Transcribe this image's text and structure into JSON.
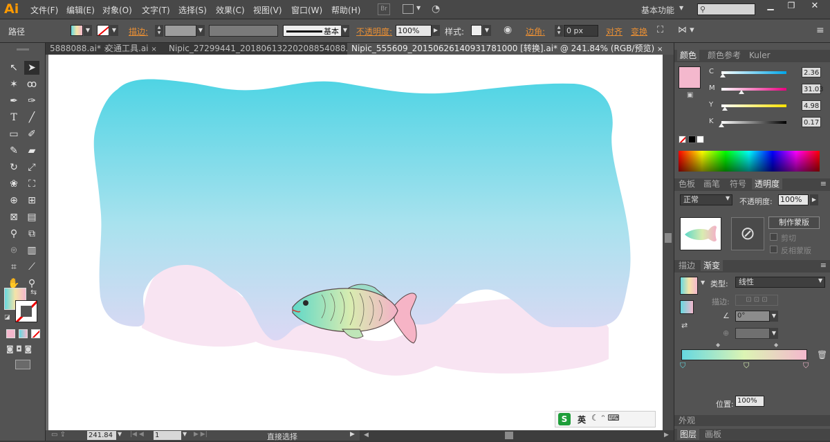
{
  "app": {
    "logo": "Ai",
    "workspace": "基本功能"
  },
  "menu": [
    "文件(F)",
    "编辑(E)",
    "对象(O)",
    "文字(T)",
    "选择(S)",
    "效果(C)",
    "视图(V)",
    "窗口(W)",
    "帮助(H)"
  ],
  "control": {
    "selection_label": "路径",
    "stroke_label": "描边:",
    "stroke_style": "基本",
    "opacity_label": "不透明度:",
    "opacity_value": "100%",
    "style_label": "样式:",
    "corner_label": "边角:",
    "corner_value": "0 px",
    "align_label": "对齐",
    "transform_label": "变换",
    "br_badge": "Br"
  },
  "tabs": [
    {
      "label": "5888088.ai*",
      "active": false
    },
    {
      "label": "交通工具.ai",
      "active": false
    },
    {
      "label": "Nipic_27299441_20180613220208854088.ai*",
      "active": false
    },
    {
      "label": "Nipic_555609_20150626140931781000 [转换].ai* @ 241.84% (RGB/预览)",
      "active": true
    }
  ],
  "status": {
    "zoom": "241.84",
    "page": "1",
    "tool": "直接选择"
  },
  "color_panel": {
    "tabs": [
      "颜色",
      "颜色参考",
      "Kuler"
    ],
    "channels": [
      {
        "name": "C",
        "value": "2.36",
        "level": 0.0236
      },
      {
        "name": "M",
        "value": "31.03",
        "level": 0.3103
      },
      {
        "name": "Y",
        "value": "4.98",
        "level": 0.0498
      },
      {
        "name": "K",
        "value": "0.17",
        "level": 0.0017
      }
    ],
    "swatch_color": "#f4b8cd"
  },
  "transparency_panel": {
    "tabs": [
      "色板",
      "画笔",
      "符号",
      "透明度"
    ],
    "blend_mode": "正常",
    "opacity_label": "不透明度:",
    "opacity_value": "100%",
    "make_mask": "制作蒙版",
    "clip": "剪切",
    "invert_mask": "反相蒙版"
  },
  "gradient_panel": {
    "tabs": [
      "描边",
      "渐变"
    ],
    "type_label": "类型:",
    "type_value": "线性",
    "stroke_label": "描边:",
    "angle_value": "0°",
    "location_label": "位置:",
    "location_value": "100%"
  },
  "bottom_panel": {
    "appearance": "外观",
    "layers": "图层",
    "artboard": "画板"
  },
  "ime": {
    "lang": "英"
  },
  "colors": {
    "sky_top": "#4fd4e4",
    "sky_bottom": "#d4d6f4",
    "pink": "#f6d4ec",
    "accent": "#e98f34"
  }
}
